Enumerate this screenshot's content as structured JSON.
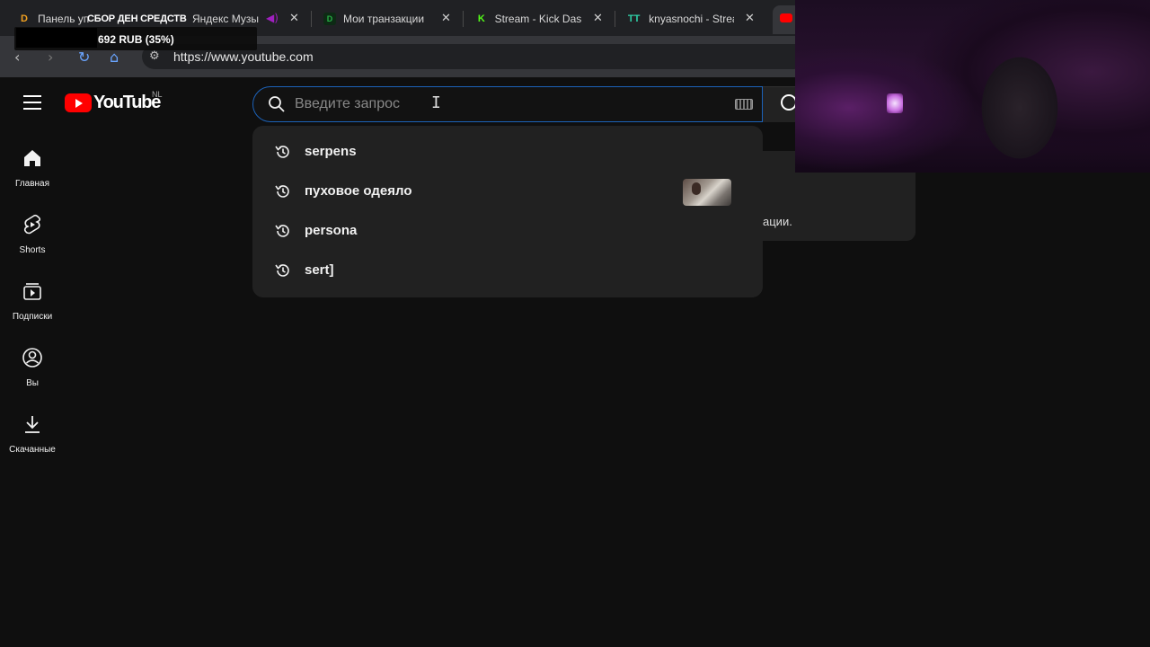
{
  "browser": {
    "tabs": [
      {
        "title": "Панель уп",
        "favicon": "D",
        "favicon_color": "#f0a020"
      },
      {
        "title": "Яндекс Музы",
        "favicon": "audio-icon",
        "favicon_color": "#a020c0"
      },
      {
        "title": "Мои транзакции",
        "favicon": "D",
        "favicon_color": "#28b046"
      },
      {
        "title": "Stream - Kick Dasl",
        "favicon": "K",
        "favicon_color": "#53fc18"
      },
      {
        "title": "knyasnochi - Strea",
        "favicon": "TT",
        "favicon_color": "#2fd1a8"
      }
    ],
    "tab_close_glyph": "✕",
    "url": "https://www.youtube.com"
  },
  "overlay": {
    "donation_title": "СБОР ДЕН СРЕДСТВ",
    "donation_amount": "692 RUB (35%)",
    "donation_progress": 0.35
  },
  "header": {
    "logo_text": "YouTube",
    "region": "NL",
    "search_placeholder": "Введите запрос"
  },
  "sidebar": {
    "items": [
      {
        "label": "Главная",
        "icon": "home-icon"
      },
      {
        "label": "Shorts",
        "icon": "shorts-icon"
      },
      {
        "label": "Подписки",
        "icon": "subscriptions-icon"
      },
      {
        "label": "Вы",
        "icon": "you-icon"
      },
      {
        "label": "Скачанные",
        "icon": "downloads-icon"
      }
    ]
  },
  "suggestions": [
    {
      "text": "serpens"
    },
    {
      "text": "пуховое одеяло"
    },
    {
      "text": "persona"
    },
    {
      "text": "sert]"
    }
  ],
  "notice": {
    "text_fragment": "ации."
  },
  "colors": {
    "accent": "#1c62b9",
    "brand_red": "#ff0000",
    "background": "#0f0f0f"
  }
}
